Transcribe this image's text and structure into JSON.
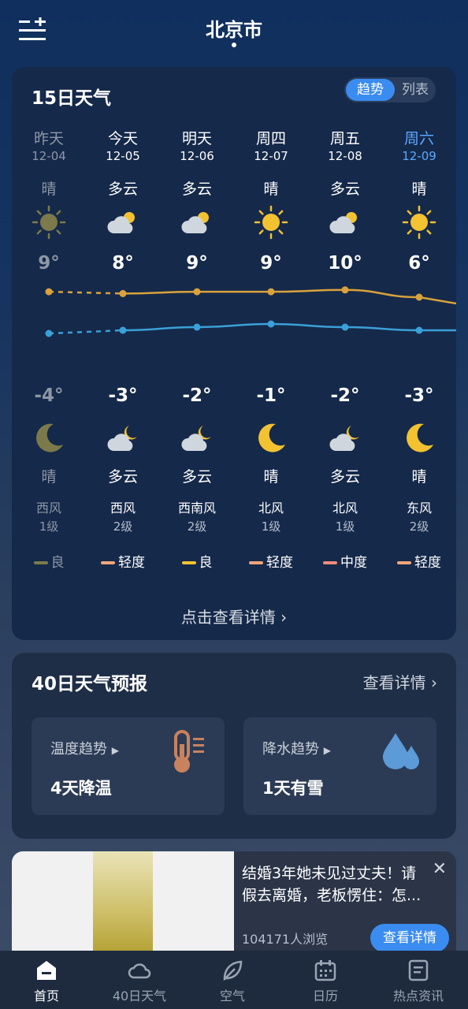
{
  "header": {
    "city": "北京市"
  },
  "card15": {
    "title": "15日天气",
    "toggle": {
      "trend": "趋势",
      "list": "列表"
    },
    "detail_link": "点击查看详情",
    "days": [
      {
        "name": "昨天",
        "date": "12-04",
        "day_weather": "晴",
        "day_icon": "sun-icon",
        "high": "9°",
        "low": "-4°",
        "night_icon": "moon-icon",
        "night_weather": "晴",
        "wind_dir": "西风",
        "wind_level": "1级",
        "aqi": "良",
        "aqi_color": "#7c7a4a",
        "state": "past"
      },
      {
        "name": "今天",
        "date": "12-05",
        "day_weather": "多云",
        "day_icon": "cloudy-day-icon",
        "high": "8°",
        "low": "-3°",
        "night_icon": "cloudy-night-icon",
        "night_weather": "多云",
        "wind_dir": "西风",
        "wind_level": "2级",
        "aqi": "轻度",
        "aqi_color": "#f2a57a",
        "state": "today"
      },
      {
        "name": "明天",
        "date": "12-06",
        "day_weather": "多云",
        "day_icon": "cloudy-day-icon",
        "high": "9°",
        "low": "-2°",
        "night_icon": "cloudy-night-icon",
        "night_weather": "多云",
        "wind_dir": "西南风",
        "wind_level": "2级",
        "aqi": "良",
        "aqi_color": "#f2c230",
        "state": "normal"
      },
      {
        "name": "周四",
        "date": "12-07",
        "day_weather": "晴",
        "day_icon": "sun-icon",
        "high": "9°",
        "low": "-1°",
        "night_icon": "moon-icon",
        "night_weather": "晴",
        "wind_dir": "北风",
        "wind_level": "1级",
        "aqi": "轻度",
        "aqi_color": "#f2a57a",
        "state": "normal"
      },
      {
        "name": "周五",
        "date": "12-08",
        "day_weather": "多云",
        "day_icon": "cloudy-day-icon",
        "high": "10°",
        "low": "-2°",
        "night_icon": "cloudy-night-icon",
        "night_weather": "多云",
        "wind_dir": "北风",
        "wind_level": "1级",
        "aqi": "中度",
        "aqi_color": "#f28a7a",
        "state": "normal"
      },
      {
        "name": "周六",
        "date": "12-09",
        "day_weather": "晴",
        "day_icon": "sun-icon",
        "high": "6°",
        "low": "-3°",
        "night_icon": "moon-icon",
        "night_weather": "晴",
        "wind_dir": "东风",
        "wind_level": "2级",
        "aqi": "轻度",
        "aqi_color": "#f2a57a",
        "state": "weekend"
      }
    ],
    "high_values": [
      9,
      8,
      9,
      9,
      10,
      6
    ],
    "low_values": [
      -4,
      -3,
      -2,
      -1,
      -2,
      -3
    ],
    "colors": {
      "high_line": "#d9a23d",
      "low_line": "#3aa0d8",
      "accent": "#3b8cf0"
    }
  },
  "card40": {
    "title": "40日天气预报",
    "more": "查看详情",
    "temp_tile": {
      "label": "温度趋势",
      "value": "4天降温",
      "icon": "thermometer-icon"
    },
    "rain_tile": {
      "label": "降水趋势",
      "value": "1天有雪",
      "icon": "raindrops-icon"
    }
  },
  "ad": {
    "title": "结婚3年她未见过丈夫！请假去离婚，老板愣住：怎...",
    "views": "104171人浏览",
    "button": "查看详情"
  },
  "tabs": [
    {
      "label": "首页",
      "icon": "home-icon",
      "active": true
    },
    {
      "label": "40日天气",
      "icon": "cloud-icon",
      "active": false
    },
    {
      "label": "空气",
      "icon": "leaf-icon",
      "active": false
    },
    {
      "label": "日历",
      "icon": "calendar-icon",
      "active": false
    },
    {
      "label": "热点资讯",
      "icon": "news-icon",
      "active": false
    }
  ]
}
